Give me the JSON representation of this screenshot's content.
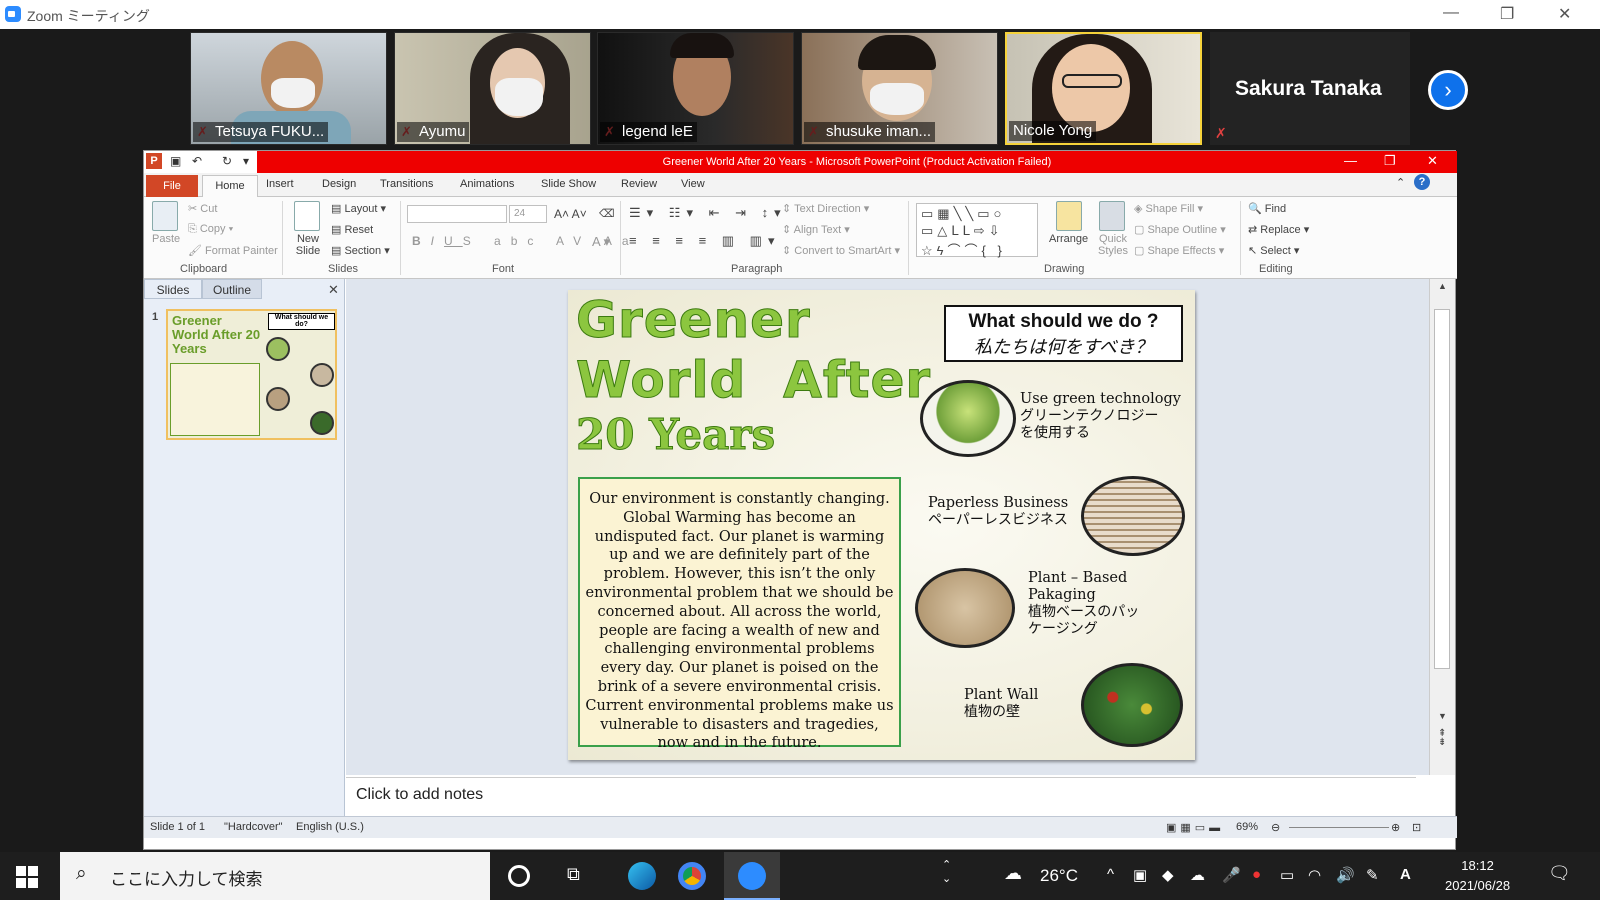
{
  "zoom": {
    "title": "Zoom ミーティング",
    "participants": [
      {
        "name": "Tetsuya FUKU..."
      },
      {
        "name": "Ayumu"
      },
      {
        "name": "legend leE"
      },
      {
        "name": "shusuke iman..."
      },
      {
        "name": "Nicole Yong"
      }
    ],
    "name_only_participant": "Sakura Tanaka"
  },
  "ppt": {
    "window_title": "Greener World After 20 Years  -  Microsoft PowerPoint (Product Activation Failed)",
    "tabs": {
      "file": "File",
      "home": "Home",
      "insert": "Insert",
      "design": "Design",
      "transitions": "Transitions",
      "animations": "Animations",
      "slideshow": "Slide Show",
      "review": "Review",
      "view": "View"
    },
    "ribbon": {
      "paste": "Paste",
      "cut": "Cut",
      "copy": "Copy",
      "format_painter": "Format Painter",
      "clipboard": "Clipboard",
      "new_slide": "New Slide",
      "layout": "Layout",
      "reset": "Reset",
      "section": "Section",
      "slides": "Slides",
      "font_size": "24",
      "font": "Font",
      "text_direction": "Text Direction",
      "align_text": "Align Text",
      "convert_smartart": "Convert to SmartArt",
      "paragraph": "Paragraph",
      "arrange": "Arrange",
      "quick_styles": "Quick Styles",
      "shape_fill": "Shape Fill",
      "shape_outline": "Shape Outline",
      "shape_effects": "Shape Effects",
      "drawing": "Drawing",
      "find": "Find",
      "replace": "Replace",
      "select": "Select",
      "editing": "Editing"
    },
    "pane_tabs": {
      "slides": "Slides",
      "outline": "Outline"
    },
    "thumbnail": {
      "number": "1",
      "title": "Greener World After 20 Years",
      "box_title": "What should we do?"
    },
    "slide": {
      "title_line1": "Greener",
      "title_line2": "World  After",
      "title_line3": "20 Years",
      "body": "Our environment is constantly changing. Global Warming has become an undisputed fact. Our planet is warming up and we are definitely part of the problem. However, this isn’t the only environmental problem that we should be concerned about. All across the world, people are facing a wealth of new and challenging environmental problems every day. Our planet is poised on the brink of a severe environmental crisis. Current environmental  problems make us vulnerable to disasters and tragedies, now and in the future.",
      "what_en": "What should we do ?",
      "what_jp": "私たちは何をすべき？",
      "items": [
        {
          "en": "Use green technology",
          "jp": "グリーンテクノロジーを使用する"
        },
        {
          "en": "Paperless Business",
          "jp": "ペーパーレスビジネス"
        },
        {
          "en": "Plant – Based Pakaging",
          "jp": "植物ベースのパッケージング"
        },
        {
          "en": "Plant Wall",
          "jp": "植物の壁"
        }
      ]
    },
    "notes_placeholder": "Click to add notes",
    "status": {
      "slide": "Slide 1 of 1",
      "theme": "\"Hardcover\"",
      "language": "English (U.S.)",
      "zoom": "69%"
    }
  },
  "taskbar": {
    "search_placeholder": "ここに入力して検索",
    "temperature": "26°C",
    "time": "18:12",
    "date": "2021/06/28"
  }
}
